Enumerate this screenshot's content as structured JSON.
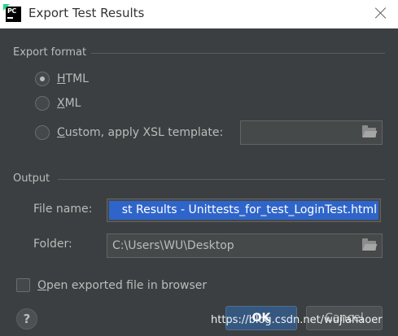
{
  "window": {
    "title": "Export Test Results",
    "app_icon_text": "PC"
  },
  "export_format": {
    "section_label": "Export format",
    "options": [
      {
        "label": "HTML",
        "mnemonic": "H",
        "rest": "TML",
        "checked": true
      },
      {
        "label": "XML",
        "mnemonic": "X",
        "rest": "ML",
        "checked": false
      },
      {
        "label": "Custom, apply XSL template:",
        "mnemonic": "C",
        "rest": "ustom, apply XSL template:",
        "checked": false
      }
    ],
    "template_path": ""
  },
  "output": {
    "section_label": "Output",
    "file_name_label": "File name:",
    "file_name_value": "st Results - Unittests_for_test_LoginTest.html",
    "folder_label": "Folder:",
    "folder_value": "C:\\Users\\WU\\Desktop"
  },
  "open_in_browser": {
    "label": "Open exported file in browser",
    "mnemonic": "O",
    "rest": "pen exported file in browser",
    "checked": false
  },
  "buttons": {
    "help": "?",
    "ok": "OK",
    "cancel": "Cancel"
  },
  "watermark": "https://blog.csdn.net/wujiahaoer",
  "colors": {
    "background": "#3c3f41",
    "selection": "#2f65ca",
    "ok_button": "#365880",
    "text": "#bbbbbb"
  }
}
